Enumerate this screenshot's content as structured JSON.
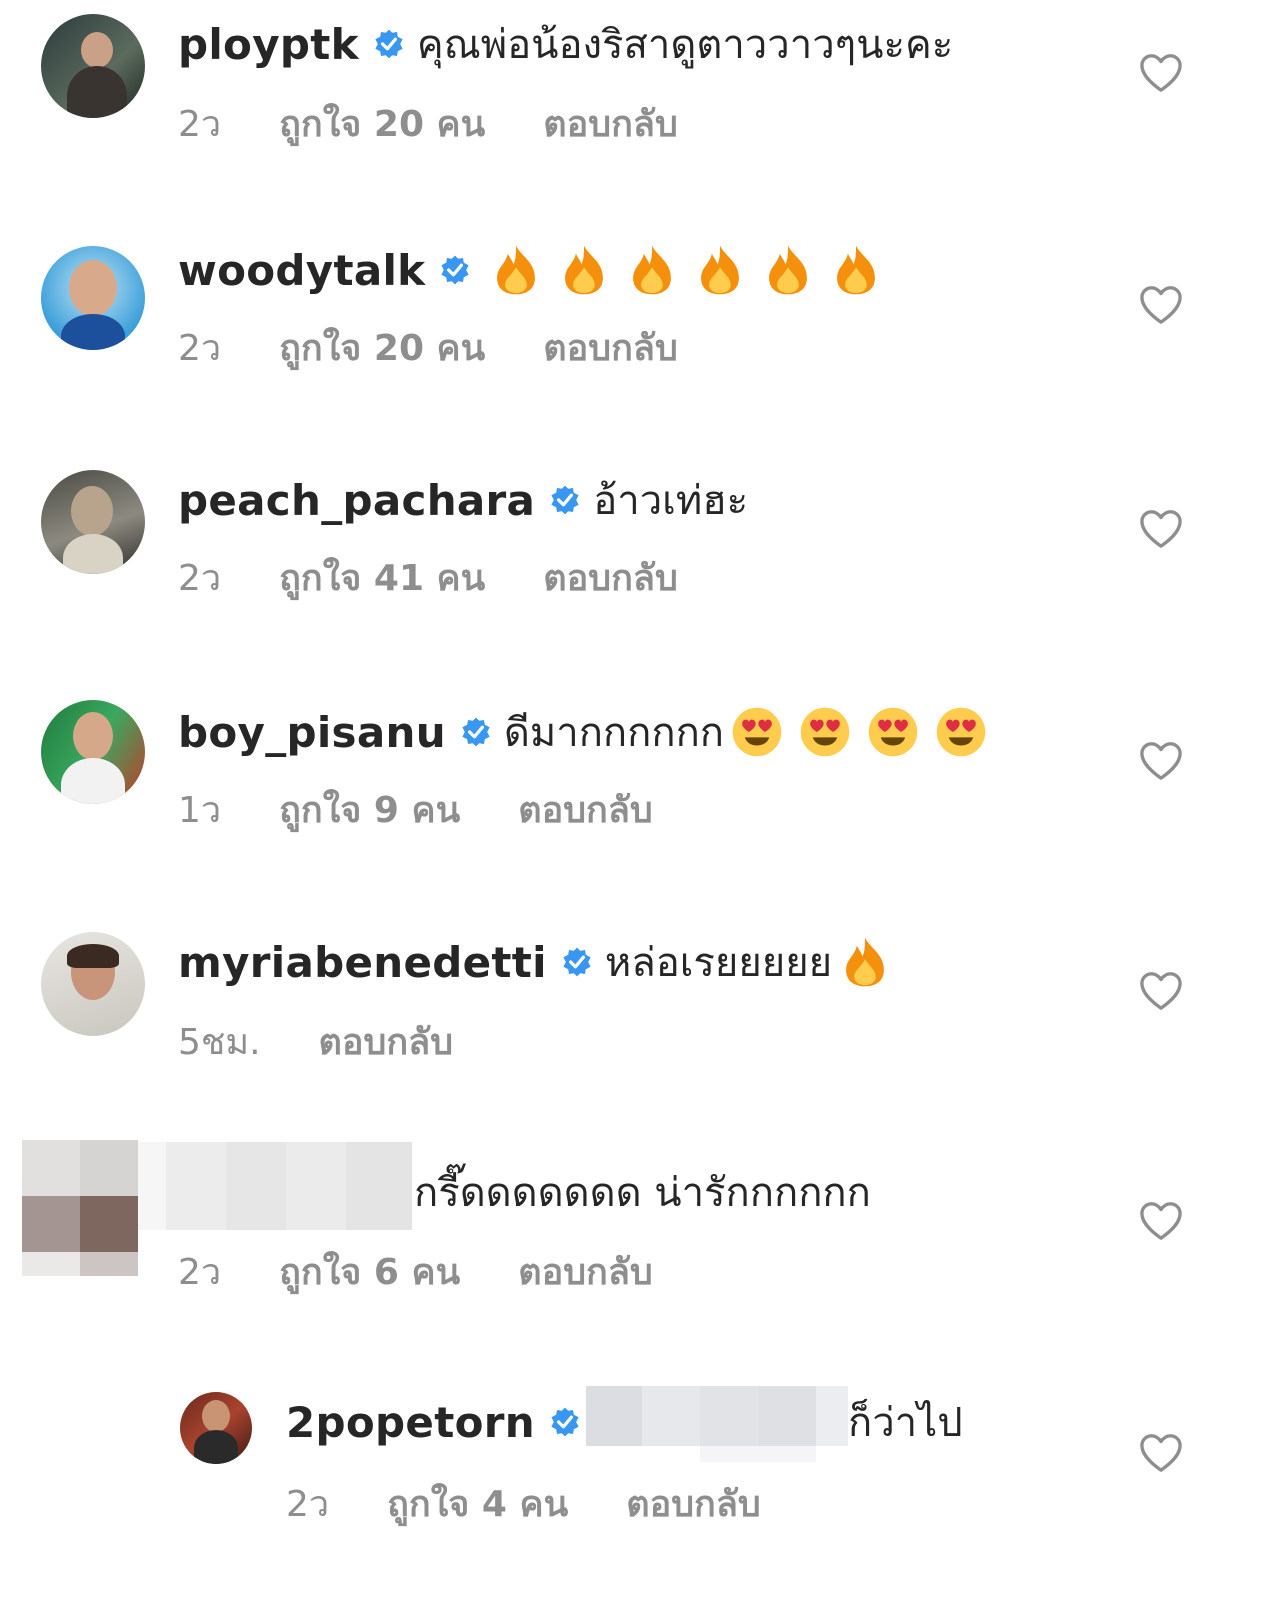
{
  "comments": [
    {
      "username": "ployptk",
      "text": "คุณพ่อน้องริสาดูตาววาวๆนะคะ",
      "emoji": [],
      "time": "2ว",
      "likes": "ถูกใจ 20 คน",
      "reply": "ตอบกลับ"
    },
    {
      "username": "woodytalk",
      "text": "",
      "emoji": [
        "fire-emoji",
        "fire-emoji",
        "fire-emoji",
        "fire-emoji",
        "fire-emoji",
        "fire-emoji"
      ],
      "time": "2ว",
      "likes": "ถูกใจ 20 คน",
      "reply": "ตอบกลับ"
    },
    {
      "username": "peach_pachara",
      "text": "อ้าวเท่ฮะ",
      "emoji": [],
      "time": "2ว",
      "likes": "ถูกใจ 41 คน",
      "reply": "ตอบกลับ"
    },
    {
      "username": "boy_pisanu",
      "text": "ดีมากกกกกก",
      "emoji": [
        "heart-eyes-emoji",
        "heart-eyes-emoji",
        "heart-eyes-emoji",
        "heart-eyes-emoji"
      ],
      "time": "1ว",
      "likes": "ถูกใจ 9 คน",
      "reply": "ตอบกลับ"
    },
    {
      "username": "myriabenedetti",
      "text": "หล่อเรยยยยย",
      "emoji": [
        "fire-emoji"
      ],
      "time": "5ชม.",
      "likes": "",
      "reply": "ตอบกลับ"
    },
    {
      "username": "",
      "text": "กรี๊ดดดดดดด น่ารักกกกกก",
      "emoji": [],
      "time": "2ว",
      "likes": "ถูกใจ 6 คน",
      "reply": "ตอบกลับ"
    },
    {
      "username": "2popetorn",
      "text": "ก็ว่าไป",
      "text_prefix": "(",
      "emoji": [],
      "time": "2ว",
      "likes": "ถูกใจ 4 คน",
      "reply": "ตอบกลับ"
    }
  ],
  "colors": {
    "text": "#262626",
    "meta": "#8e8e8e",
    "verified": "#3897f0",
    "heart_outline": "#8e8e8e"
  }
}
